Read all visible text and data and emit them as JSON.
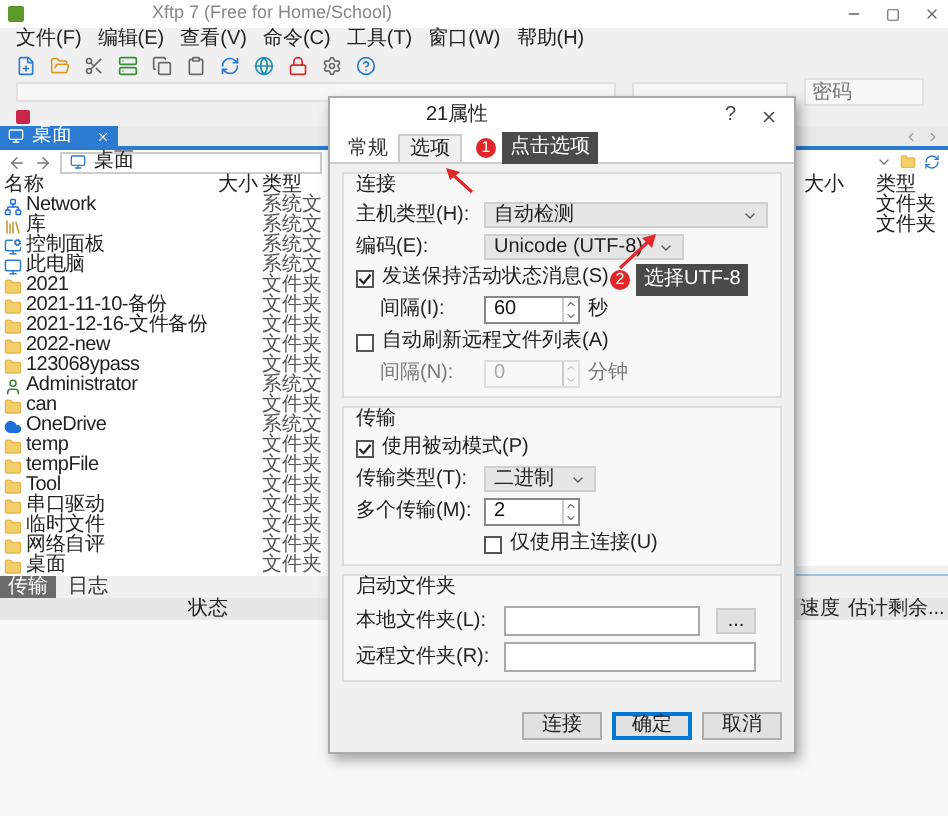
{
  "window": {
    "title": "Xftp 7 (Free for Home/School)"
  },
  "menu": [
    "文件(F)",
    "编辑(E)",
    "查看(V)",
    "命令(C)",
    "工具(T)",
    "窗口(W)",
    "帮助(H)"
  ],
  "session": {
    "password_placeholder": "密码"
  },
  "left_pane": {
    "tab": "桌面",
    "path": "桌面",
    "columns": [
      "名称",
      "大小",
      "类型"
    ],
    "rows": [
      {
        "name": "Network",
        "kind": "network",
        "type": "系统文"
      },
      {
        "name": "库",
        "kind": "library",
        "type": "系统文"
      },
      {
        "name": "控制面板",
        "kind": "control_panel",
        "type": "系统文"
      },
      {
        "name": "此电脑",
        "kind": "computer",
        "type": "系统文"
      },
      {
        "name": "2021",
        "kind": "folder",
        "type": "文件夹"
      },
      {
        "name": "2021-11-10-备份",
        "kind": "folder",
        "type": "文件夹"
      },
      {
        "name": "2021-12-16-文件备份",
        "kind": "folder",
        "type": "文件夹"
      },
      {
        "name": "2022-new",
        "kind": "folder",
        "type": "文件夹"
      },
      {
        "name": "123068ypass",
        "kind": "folder",
        "type": "文件夹"
      },
      {
        "name": "Administrator",
        "kind": "user",
        "type": "系统文"
      },
      {
        "name": "can",
        "kind": "folder",
        "type": "文件夹"
      },
      {
        "name": "OneDrive",
        "kind": "cloud",
        "type": "系统文"
      },
      {
        "name": "temp",
        "kind": "folder",
        "type": "文件夹"
      },
      {
        "name": "tempFile",
        "kind": "folder",
        "type": "文件夹"
      },
      {
        "name": "Tool",
        "kind": "folder",
        "type": "文件夹"
      },
      {
        "name": "串口驱动",
        "kind": "folder",
        "type": "文件夹"
      },
      {
        "name": "临时文件",
        "kind": "folder",
        "type": "文件夹"
      },
      {
        "name": "网络自评",
        "kind": "folder",
        "type": "文件夹"
      },
      {
        "name": "桌面",
        "kind": "folder",
        "type": "文件夹"
      }
    ]
  },
  "right_pane": {
    "columns": [
      "大小",
      "类型"
    ],
    "rows": [
      {
        "type": "文件夹"
      },
      {
        "type": "文件夹"
      }
    ]
  },
  "bottom": {
    "tabs": [
      {
        "label": "传输",
        "selected": true
      },
      {
        "label": "日志",
        "selected": false
      }
    ],
    "columns": [
      "状态",
      "速度",
      "估计剩余..."
    ]
  },
  "dialog": {
    "title": "21属性",
    "help": "?",
    "tabs": [
      {
        "label": "常规",
        "selected": false
      },
      {
        "label": "选项",
        "selected": true
      }
    ],
    "connection": {
      "title": "连接",
      "host_type": {
        "label": "主机类型(H):",
        "value": "自动检测"
      },
      "encoding": {
        "label": "编码(E):",
        "value": "Unicode (UTF-8)"
      },
      "keepalive": {
        "label": "发送保持活动状态消息(S)",
        "checked": true
      },
      "keepalive_interval": {
        "label": "间隔(I):",
        "value": "60",
        "unit": "秒",
        "disabled": false
      },
      "auto_refresh": {
        "label": "自动刷新远程文件列表(A)",
        "checked": false
      },
      "refresh_interval": {
        "label": "间隔(N):",
        "value": "0",
        "unit": "分钟",
        "disabled": true
      }
    },
    "transfer": {
      "title": "传输",
      "passive": {
        "label": "使用被动模式(P)",
        "checked": true
      },
      "transfer_type": {
        "label": "传输类型(T):",
        "value": "二进制"
      },
      "concurrent": {
        "label": "多个传输(M):",
        "value": "2"
      },
      "main_only": {
        "label": "仅使用主连接(U)",
        "checked": false
      }
    },
    "startup": {
      "title": "启动文件夹",
      "local": {
        "label": "本地文件夹(L):",
        "browse": "..."
      },
      "remote": {
        "label": "远程文件夹(R):"
      }
    },
    "buttons": [
      {
        "label": "连接",
        "default": false
      },
      {
        "label": "确定",
        "default": true
      },
      {
        "label": "取消",
        "default": false
      }
    ]
  },
  "annotations": [
    {
      "number": "1",
      "text": "点击选项"
    },
    {
      "number": "2",
      "text": "选择UTF-8"
    }
  ]
}
